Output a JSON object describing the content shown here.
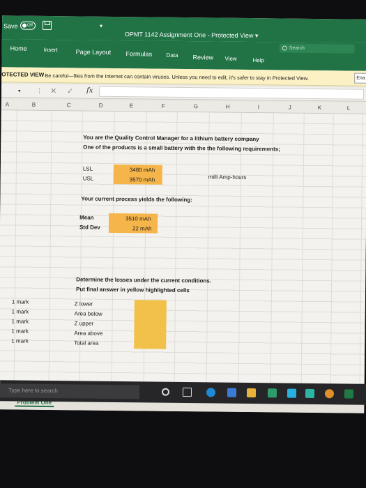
{
  "titlebar": {
    "autosave_label": "Save",
    "autosave_state": "Off",
    "qat_dropdown": "▾",
    "doc_title": "OPMT 1142 Assignment One  -  Protected View  ▾",
    "search_label": "Search"
  },
  "ribbon": {
    "tabs": [
      "Home",
      "Insert",
      "Page Layout",
      "Formulas",
      "Data",
      "Review",
      "View",
      "Help"
    ]
  },
  "protected_view": {
    "label": "OTECTED VIEW",
    "message": "Be careful—files from the Internet can contain viruses. Unless you need to edit, it's safer to stay in Protected View.",
    "enable_button": "Ena"
  },
  "formula_bar": {
    "fx": "fx",
    "cancel": "✕",
    "enter": "✓",
    "more": "⋮",
    "namebox_arrow": "▾"
  },
  "columns": [
    "A",
    "B",
    "C",
    "D",
    "E",
    "F",
    "G",
    "H",
    "I",
    "J",
    "K",
    "L"
  ],
  "sheet": {
    "intro1": "You are the Quality Control Manager for a lithium battery company",
    "intro2": "One of the products is a small battery with the the following requirements;",
    "lsl_label": "LSL",
    "lsl_value": "3480 mAh",
    "usl_label": "USL",
    "usl_value": "3570 mAh",
    "unit_note": "milli Amp-hours",
    "process_intro": "Your current process yields the following:",
    "mean_label": "Mean",
    "mean_value": "3510 mAh",
    "std_label": "Std Dev",
    "std_value": "22 mAh",
    "task1": "Determine the losses under the current conditions.",
    "task2": "Put final answer in yellow highlighted cells",
    "marks": [
      "1 mark",
      "1 mark",
      "1 mark",
      "1 mark",
      "1 mark"
    ],
    "answer_labels": [
      "Z lower",
      "Area below",
      "Z upper",
      "Area above",
      "Total area"
    ]
  },
  "sheet_tabs": {
    "active": "Problem One"
  },
  "taskbar": {
    "search_placeholder": "Type here to search"
  },
  "colors": {
    "excel_green": "#217346",
    "highlight_orange": "#f5b54a",
    "highlight_yellow": "#f2c14a",
    "protected_bar": "#fbf1c4"
  }
}
